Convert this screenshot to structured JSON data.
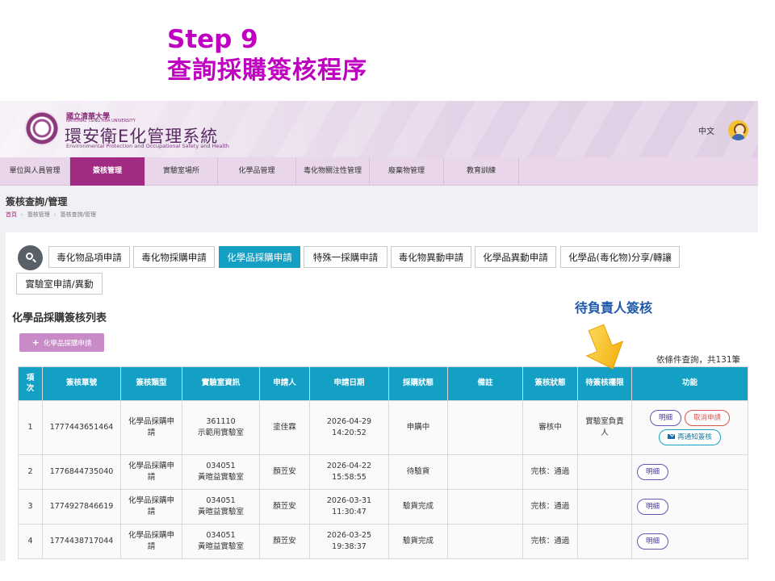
{
  "slide": {
    "step": "Step 9",
    "subtitle": "查詢採購簽核程序"
  },
  "header": {
    "univ_name": "國立清華大學",
    "univ_name_en": "NATIONAL TSING HUA UNIVERSITY",
    "system_name": "環安衛E化管理系統",
    "system_name_en": "Environmental Protection and Occupational Safety and Health",
    "language": "中文"
  },
  "nav": {
    "items": [
      {
        "label": "單位與人員管理"
      },
      {
        "label": "簽核管理",
        "active": true
      },
      {
        "label": "實驗室場所"
      },
      {
        "label": "化學品管理"
      },
      {
        "label": "毒化物關注性管理"
      },
      {
        "label": "廢棄物管理"
      },
      {
        "label": "教育訓練"
      }
    ]
  },
  "page": {
    "heading": "簽核查詢/管理",
    "breadcrumb": [
      "首頁",
      "簽核管理",
      "簽核查詢/管理"
    ]
  },
  "tabs": [
    {
      "label": "毒化物品項申請"
    },
    {
      "label": "毒化物採購申請"
    },
    {
      "label": "化學品採購申請",
      "active": true
    },
    {
      "label": "特殊一採購申請"
    },
    {
      "label": "毒化物異動申請"
    },
    {
      "label": "化學品異動申請"
    },
    {
      "label": "化學品(毒化物)分享/轉讓"
    },
    {
      "label": "實驗室申請/異動"
    }
  ],
  "list": {
    "title": "化學品採購簽核列表",
    "add_button": "化學品採購申請",
    "count_text": "依條件查詢，共131筆"
  },
  "table": {
    "headers": [
      "項次",
      "簽核單號",
      "簽核類型",
      "實驗室資訊",
      "申請人",
      "申請日期",
      "採購狀態",
      "備註",
      "簽核狀態",
      "待簽核權限",
      "功能"
    ],
    "rows": [
      {
        "no": "1",
        "id": "1777443651464",
        "type": "化學品採購申請",
        "lab_code": "361110",
        "lab_name": "示範用實驗室",
        "applicant": "塗佳霖",
        "date": "2026-04-29",
        "time": "14:20:52",
        "purchase_status": "申購中",
        "note": "",
        "sign_status": "審核中",
        "pending_role": "實驗室負責人",
        "actions": [
          "明細",
          "取消申請",
          "再通知簽核"
        ]
      },
      {
        "no": "2",
        "id": "1776844735040",
        "type": "化學品採購申請",
        "lab_code": "034051",
        "lab_name": "黃暄益實驗室",
        "applicant": "顏苙安",
        "date": "2026-04-22",
        "time": "15:58:55",
        "purchase_status": "待驗貨",
        "note": "",
        "sign_status": "完核：通過",
        "pending_role": "",
        "actions": [
          "明細"
        ]
      },
      {
        "no": "3",
        "id": "1774927846619",
        "type": "化學品採購申請",
        "lab_code": "034051",
        "lab_name": "黃暄益實驗室",
        "applicant": "顏苙安",
        "date": "2026-03-31",
        "time": "11:30:47",
        "purchase_status": "驗貨完成",
        "note": "",
        "sign_status": "完核：通過",
        "pending_role": "",
        "actions": [
          "明細"
        ]
      },
      {
        "no": "4",
        "id": "1774438717044",
        "type": "化學品採購申請",
        "lab_code": "034051",
        "lab_name": "黃暄益實驗室",
        "applicant": "顏苙安",
        "date": "2026-03-25",
        "time": "19:38:37",
        "purchase_status": "驗貨完成",
        "note": "",
        "sign_status": "完核：通過",
        "pending_role": "",
        "actions": [
          "明細"
        ]
      }
    ]
  },
  "annotation": {
    "text": "待負責人簽核"
  },
  "colors": {
    "title": "#c000c0",
    "brand": "#a12a82",
    "accent": "#14a0c4",
    "annotation": "#1e58a8"
  }
}
